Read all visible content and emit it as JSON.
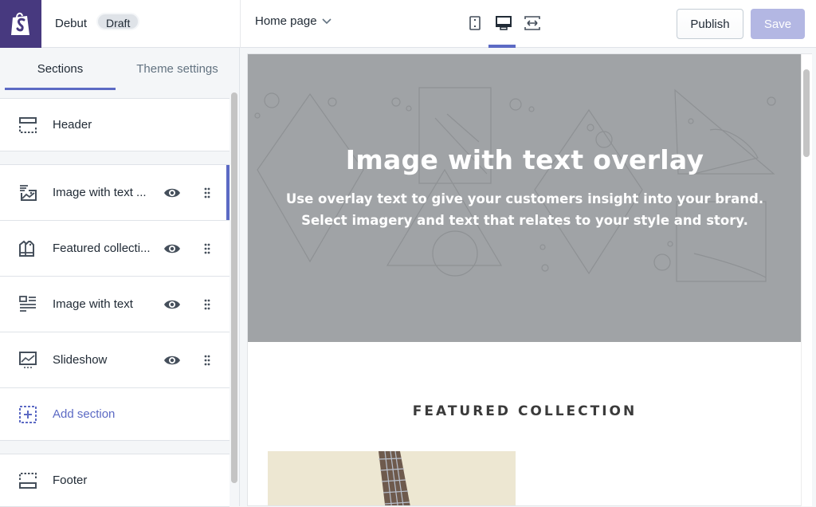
{
  "topbar": {
    "theme_name": "Debut",
    "status_badge": "Draft",
    "page_select": "Home page",
    "view_modes": [
      {
        "name": "mobile",
        "icon": "mobile-icon"
      },
      {
        "name": "desktop",
        "icon": "desktop-icon",
        "active": true
      },
      {
        "name": "fullscreen",
        "icon": "fullscreen-icon"
      }
    ],
    "publish_label": "Publish",
    "save_label": "Save"
  },
  "sidebar": {
    "tabs": [
      {
        "label": "Sections",
        "active": true
      },
      {
        "label": "Theme settings",
        "active": false
      }
    ],
    "header_item": {
      "label": "Header",
      "icon": "header-icon"
    },
    "sections": [
      {
        "label": "Image with text ...",
        "icon": "image-text-overlay-icon",
        "selected": true
      },
      {
        "label": "Featured collecti...",
        "icon": "featured-collection-icon"
      },
      {
        "label": "Image with text",
        "icon": "image-with-text-icon"
      },
      {
        "label": "Slideshow",
        "icon": "slideshow-icon"
      }
    ],
    "add_section_label": "Add section",
    "footer_item": {
      "label": "Footer",
      "icon": "footer-icon"
    }
  },
  "preview": {
    "hero_title": "Image with text overlay",
    "hero_subtitle": "Use overlay text to give your customers insight into your brand. Select imagery and text that relates to your style and story.",
    "featured_collection_title": "FEATURED COLLECTION"
  },
  "colors": {
    "accent": "#5c6ac4",
    "logo_bg": "#47397f",
    "save_disabled": "#b3b7e3",
    "hero_bg": "#a0a3a6"
  }
}
